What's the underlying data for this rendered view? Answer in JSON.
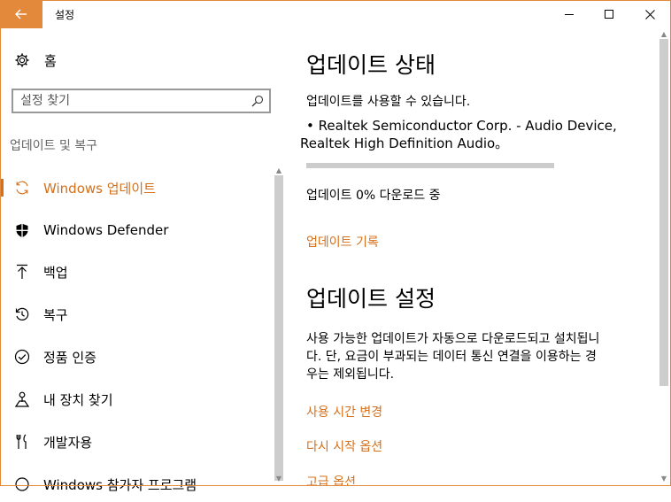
{
  "window": {
    "title": "설정",
    "accent_color": "#d4701c",
    "back_icon": "arrow-left-icon"
  },
  "sidebar": {
    "home_label": "홈",
    "search_placeholder": "설정 찾기",
    "section_label": "업데이트 및 복구",
    "items": [
      {
        "label": "Windows 업데이트",
        "icon": "sync-icon",
        "active": true
      },
      {
        "label": "Windows Defender",
        "icon": "shield-icon",
        "active": false
      },
      {
        "label": "백업",
        "icon": "backup-arrow-up-icon",
        "active": false
      },
      {
        "label": "복구",
        "icon": "recovery-history-icon",
        "active": false
      },
      {
        "label": "정품 인증",
        "icon": "check-circle-icon",
        "active": false
      },
      {
        "label": "내 장치 찾기",
        "icon": "person-location-icon",
        "active": false
      },
      {
        "label": "개발자용",
        "icon": "developer-tools-icon",
        "active": false
      },
      {
        "label": "Windows 참가자 프로그램",
        "icon": "insider-icon",
        "active": false
      }
    ]
  },
  "main": {
    "status_heading": "업데이트 상태",
    "status_text": "업데이트를 사용할 수 있습니다.",
    "update_item_line1": "• Realtek Semiconductor Corp. - Audio Device,",
    "update_item_line2": "Realtek High Definition Audio。",
    "progress_percent": 0,
    "download_status": "업데이트 0% 다운로드 중",
    "history_link": "업데이트 기록",
    "settings_heading": "업데이트 설정",
    "settings_desc_line1": "사용 가능한 업데이트가 자동으로 다운로드되고 설치됩니",
    "settings_desc_line2": "다. 단, 요금이 부과되는 데이터 통신 연결을 이용하는 경",
    "settings_desc_line3": "우는 제외됩니다.",
    "active_hours_link": "사용 시간 변경",
    "restart_options_link": "다시 시작 옵션",
    "advanced_options_link": "고급 옵션"
  }
}
